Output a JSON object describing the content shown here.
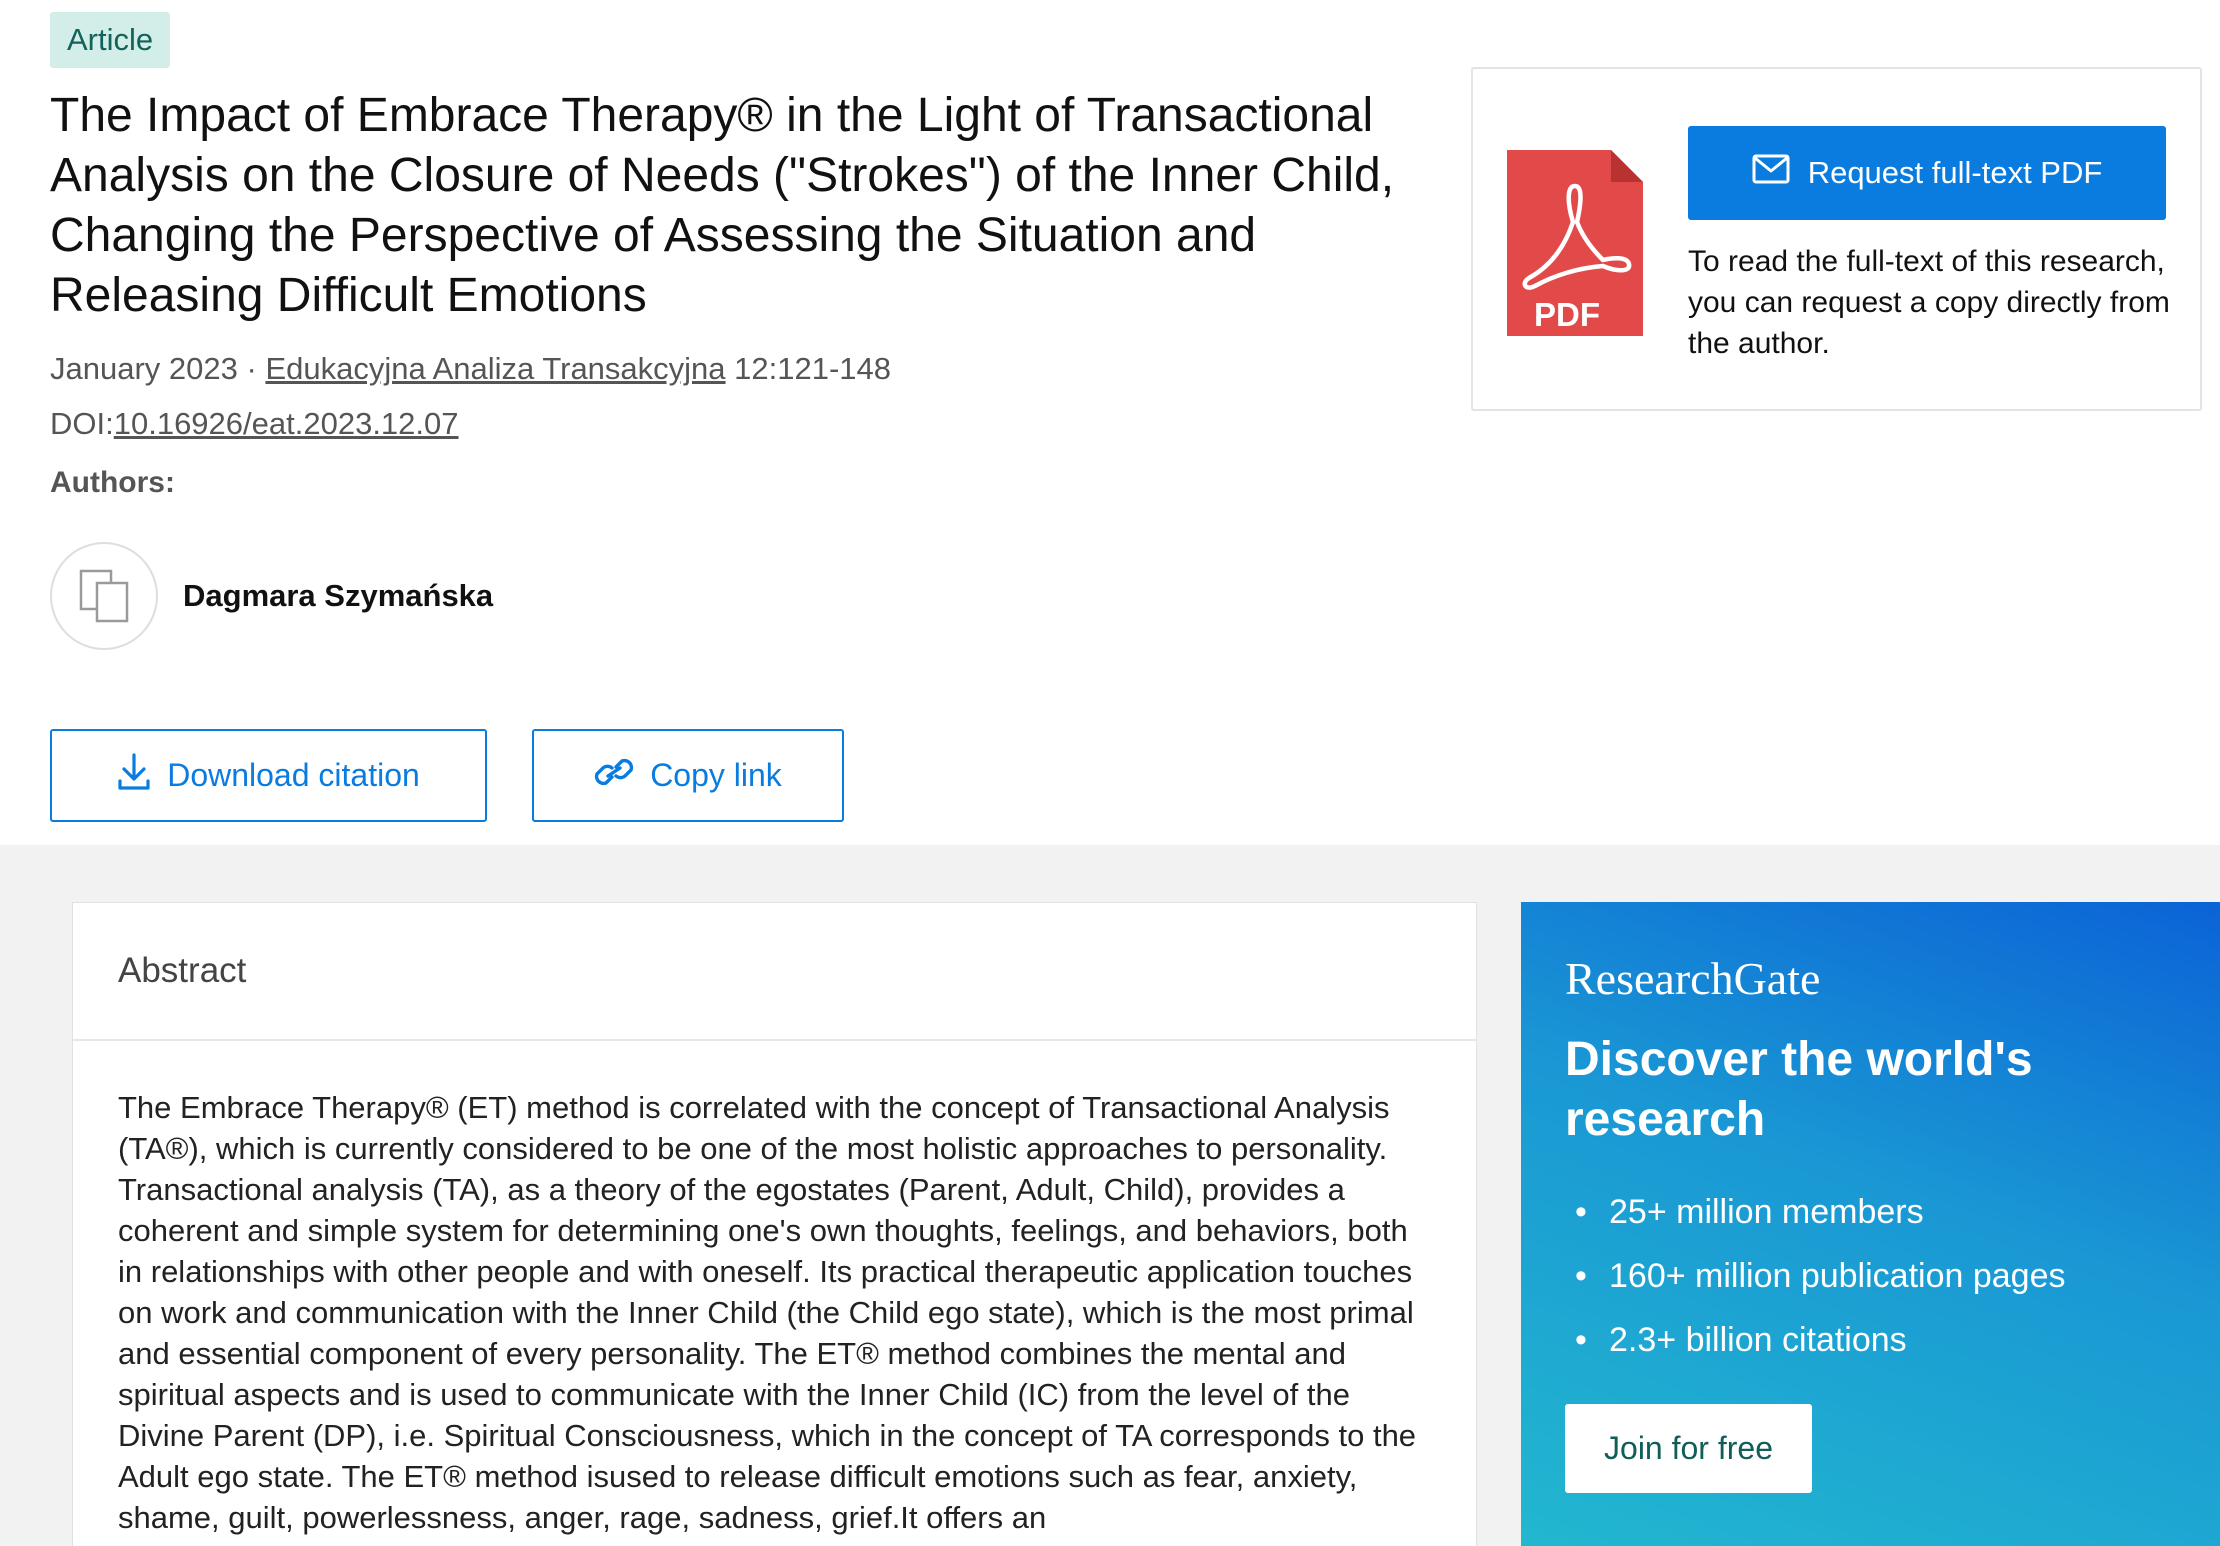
{
  "article": {
    "badge": "Article",
    "title": "The Impact of Embrace Therapy® in the Light of Transactional Analysis on the Closure of Needs (\"Strokes\") of the Inner Child, Changing the Perspective of Assessing the Situation and Releasing Difficult Emotions",
    "date": "January 2023",
    "separator": " · ",
    "journal": "Edukacyjna Analiza Transakcyjna",
    "pages": " 12:121-148",
    "doi_label": "DOI:",
    "doi": "10.16926/eat.2023.12.07",
    "authors_label": "Authors:",
    "authors": [
      {
        "name": "Dagmara Szymańska"
      }
    ]
  },
  "actions": {
    "download_citation": "Download citation",
    "copy_link": "Copy link"
  },
  "request_card": {
    "pdf_icon_label": "PDF",
    "button_label": "Request full-text PDF",
    "description": "To read the full-text of this research, you can request a copy directly from the author."
  },
  "abstract": {
    "heading": "Abstract",
    "text": "The Embrace Therapy® (ET) method is correlated with the concept of Transactional Analysis (TA®), which is currently considered to be one of the most holistic approaches to personality. Transactional analysis (TA), as a theory of the egostates (Parent, Adult, Child), provides a coherent and simple system for determining one's own thoughts, feelings, and behaviors, both in relationships with other people and with oneself. Its practical therapeutic application touches on work and communication with the Inner Child (the Child ego state), which is the most primal and essential component of every personality. The ET® method combines the mental and spiritual aspects and is used to communicate with the Inner Child (IC) from the level of the Divine Parent (DP), i.e. Spiritual Consciousness, which in the concept of TA corresponds to the Adult ego state. The ET® method isused to release difficult emotions such as fear, anxiety, shame, guilt, powerlessness, anger, rage, sadness, grief.It offers an"
  },
  "promo": {
    "brand": "ResearchGate",
    "heading": "Discover the world's research",
    "items": [
      "25+ million members",
      "160+ million publication pages",
      "2.3+ billion citations"
    ],
    "button": "Join for free"
  },
  "colors": {
    "accent": "#0a7bdf",
    "badge_bg": "#d3ede9",
    "badge_text": "#13625b",
    "pdf_red": "#e24a4a",
    "gray_bg": "#f2f2f2"
  },
  "icons": {
    "download": "download-icon",
    "link": "link-icon",
    "mail": "mail-icon",
    "pdf": "pdf-file-icon",
    "avatar": "author-placeholder-icon"
  }
}
